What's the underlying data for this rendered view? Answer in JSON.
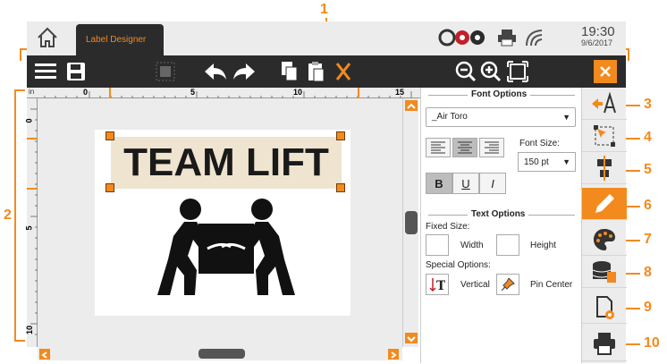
{
  "callouts": [
    "1",
    "2",
    "3",
    "4",
    "5",
    "6",
    "7",
    "8",
    "9",
    "10"
  ],
  "tab": {
    "label": "Label Designer"
  },
  "clock": {
    "time": "19:30",
    "date": "9/6/2017"
  },
  "ruler": {
    "unit": "in",
    "marks": [
      "0",
      "5",
      "10",
      "15"
    ],
    "left_marks": [
      "0",
      "5",
      "10"
    ]
  },
  "label": {
    "text": "TEAM LIFT"
  },
  "font_options": {
    "title": "Font Options",
    "font": "_Air Toro",
    "font_size_label": "Font Size:",
    "font_size": "150 pt",
    "bold": "B",
    "underline": "U",
    "italic": "I"
  },
  "text_options": {
    "title": "Text Options",
    "fixed_size_label": "Fixed Size:",
    "width_label": "Width",
    "height_label": "Height",
    "special_label": "Special Options:",
    "vertical_label": "Vertical",
    "pin_center_label": "Pin Center"
  },
  "sidebar": {
    "active_index": 3,
    "items": [
      "text-align-icon",
      "transform-icon",
      "align-center-icon",
      "pencil-icon",
      "palette-icon",
      "database-icon",
      "page-settings-icon",
      "print-icon"
    ]
  },
  "colors": {
    "accent": "#f28a1e",
    "toolbar": "#2b2b2b"
  }
}
